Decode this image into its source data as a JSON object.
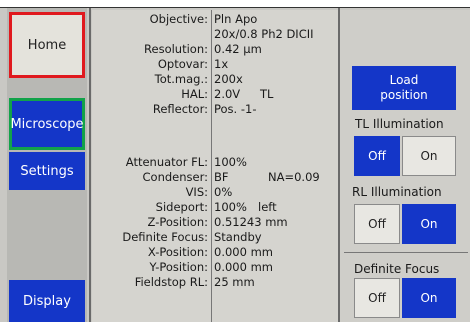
{
  "nav": {
    "home": "Home",
    "microscope": "Microscope",
    "settings": "Settings",
    "display": "Display"
  },
  "status": {
    "objective": {
      "label": "Objective:",
      "value": "Pln Apo"
    },
    "objective_detail": "20x/0.8 Ph2 DICII",
    "resolution": {
      "label": "Resolution:",
      "value": "0.42 µm"
    },
    "optovar": {
      "label": "Optovar:",
      "value": "1x"
    },
    "totmag": {
      "label": "Tot.mag.:",
      "value": "200x"
    },
    "hal": {
      "label": "HAL:",
      "value": "2.0V",
      "value2": "TL"
    },
    "reflector": {
      "label": "Reflector:",
      "value": "Pos. -1-"
    },
    "attenuator": {
      "label": "Attenuator FL:",
      "value": "100%"
    },
    "condenser": {
      "label": "Condenser:",
      "value": "BF",
      "value2": "NA=0.09"
    },
    "vis": {
      "label": "VIS:",
      "value": "0%"
    },
    "sideport": {
      "label": "Sideport:",
      "value": "100%",
      "value2": "left"
    },
    "zpos": {
      "label": "Z-Position:",
      "value": "0.51243 mm"
    },
    "definite_focus": {
      "label": "Definite Focus:",
      "value": "Standby"
    },
    "xpos": {
      "label": "X-Position:",
      "value": "0.000 mm"
    },
    "ypos": {
      "label": "Y-Position:",
      "value": "0.000 mm"
    },
    "fieldstop": {
      "label": "Fieldstop RL:",
      "value": "25 mm"
    }
  },
  "controls": {
    "load_line1": "Load",
    "load_line2": "position",
    "tl_label": "TL Illumination",
    "tl_off": "Off",
    "tl_on": "On",
    "rl_label": "RL Illumination",
    "rl_off": "Off",
    "rl_on": "On",
    "df_label": "Definite Focus",
    "df_off": "Off",
    "df_on": "On"
  },
  "colors": {
    "active_blue": "#1436c8",
    "highlight_red": "#e0191e",
    "highlight_green": "#12a24a"
  }
}
